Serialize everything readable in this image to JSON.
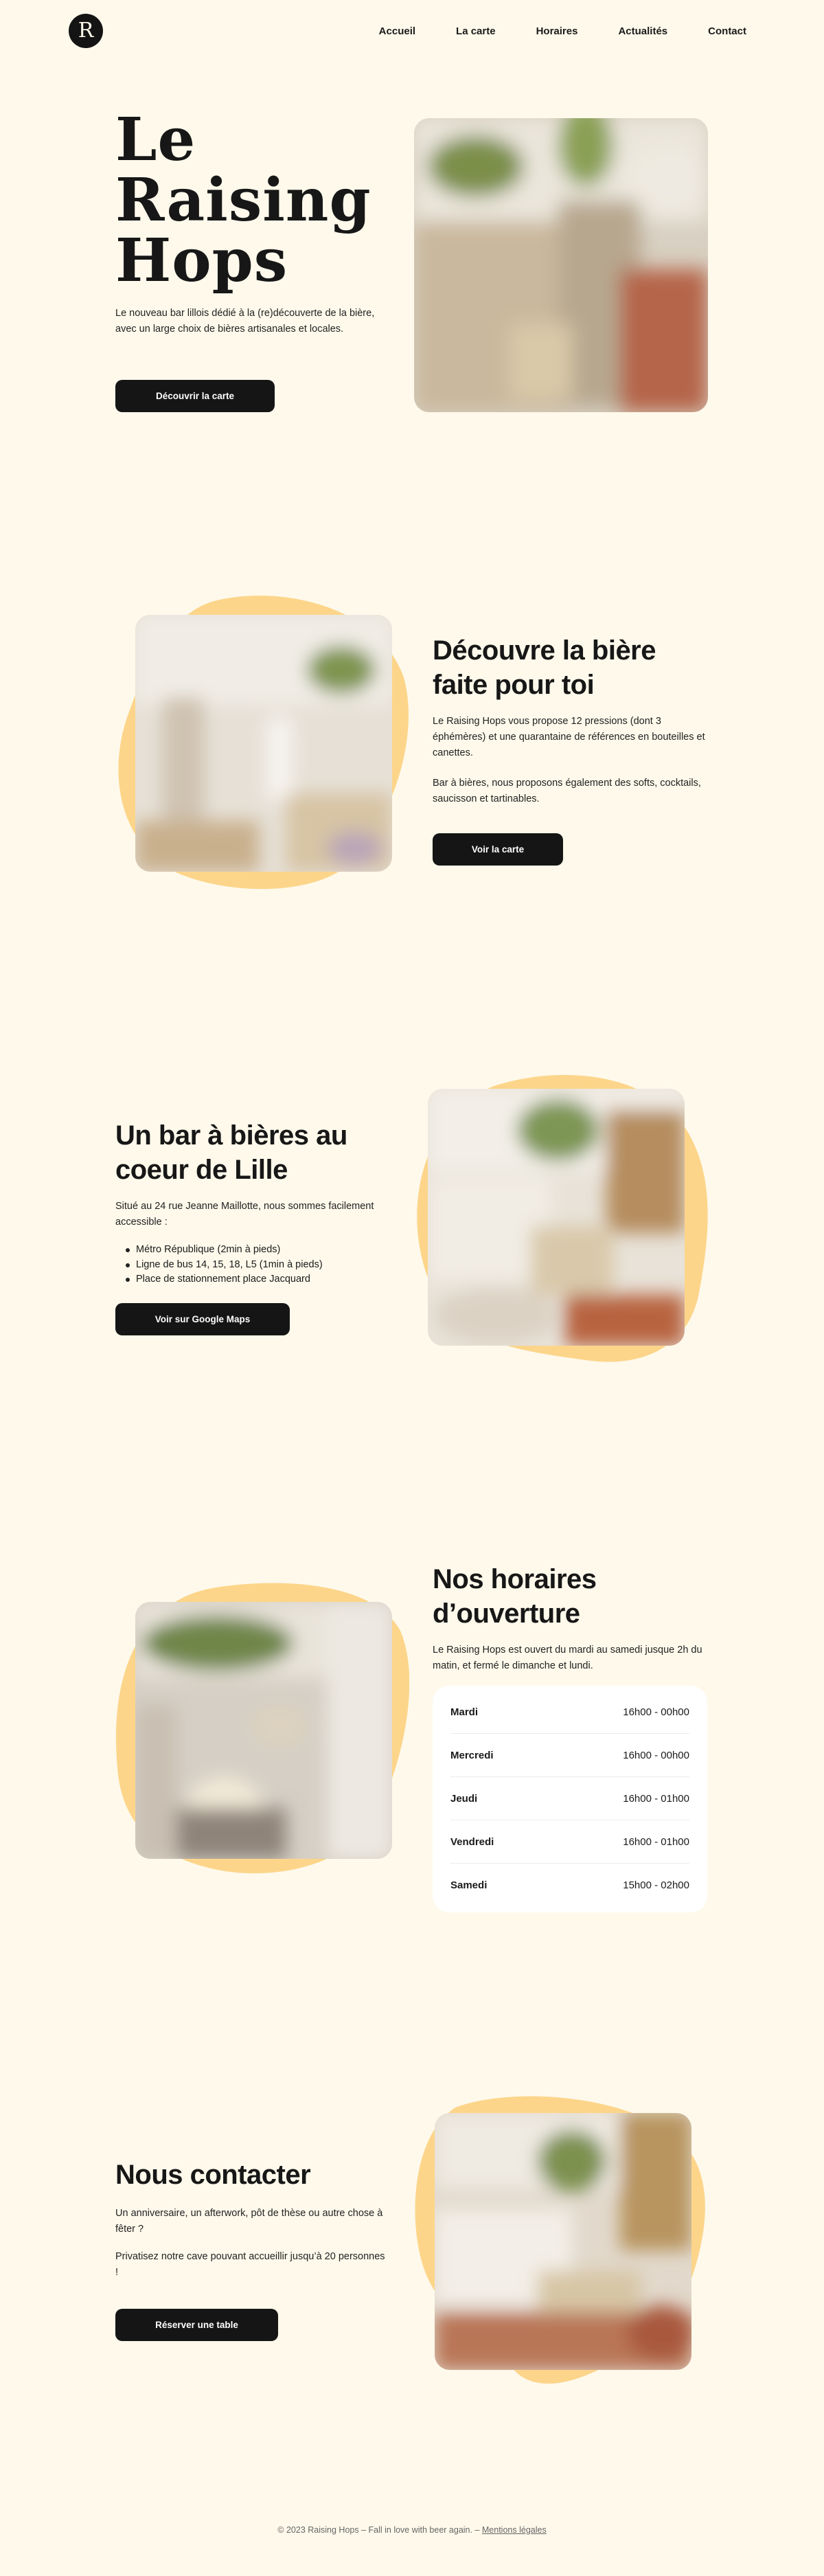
{
  "nav": {
    "logo": "R",
    "links": [
      "Accueil",
      "La carte",
      "Horaires",
      "Actualités",
      "Contact"
    ]
  },
  "hero": {
    "title_lines": [
      "Le",
      "Raising",
      "Hops"
    ],
    "text": "Le nouveau bar lillois dédié à la (re)découverte de la bière, avec un large choix de bières artisanales et locales.",
    "button": "Découvrir la carte"
  },
  "beer": {
    "title": "Découvre la bière faite pour toi",
    "text1": "Le Raising Hops vous propose 12 pressions (dont 3 éphémères) et une quarantaine de références en bouteilles et canettes.",
    "text2": "Bar à bières, nous proposons également des softs, cocktails, saucisson et tartinables.",
    "button": "Voir la carte"
  },
  "location": {
    "title": "Un bar à bières au coeur de Lille",
    "text": "Situé au 24 rue Jeanne Maillotte, nous sommes facilement accessible :",
    "items": [
      "Métro République (2min à pieds)",
      "Ligne de bus 14, 15, 18, L5 (1min à pieds)",
      "Place de stationnement place Jacquard"
    ],
    "button": "Voir sur Google Maps"
  },
  "hours": {
    "title": "Nos horaires d’ouverture",
    "text": "Le Raising Hops est ouvert du mardi au samedi jusque 2h du matin, et fermé le dimanche et lundi.",
    "rows": [
      {
        "day": "Mardi",
        "time": "16h00 - 00h00"
      },
      {
        "day": "Mercredi",
        "time": "16h00 - 00h00"
      },
      {
        "day": "Jeudi",
        "time": "16h00 - 01h00"
      },
      {
        "day": "Vendredi",
        "time": "16h00 - 01h00"
      },
      {
        "day": "Samedi",
        "time": "15h00 - 02h00"
      }
    ]
  },
  "contact": {
    "title": "Nous contacter",
    "text1": "Un anniversaire, un afterwork, pôt de thèse ou autre chose à fêter ?",
    "text2": "Privatisez notre cave pouvant accueillir jusqu’à 20 personnes !",
    "button": "Réserver une table"
  },
  "footer": {
    "copyright": "© 2023 Raising Hops – Fall in love with beer again. –",
    "legal": "Mentions légales"
  },
  "colors": {
    "background": "#FEF9EB",
    "blob": "#FDD58A",
    "button": "#151515"
  }
}
